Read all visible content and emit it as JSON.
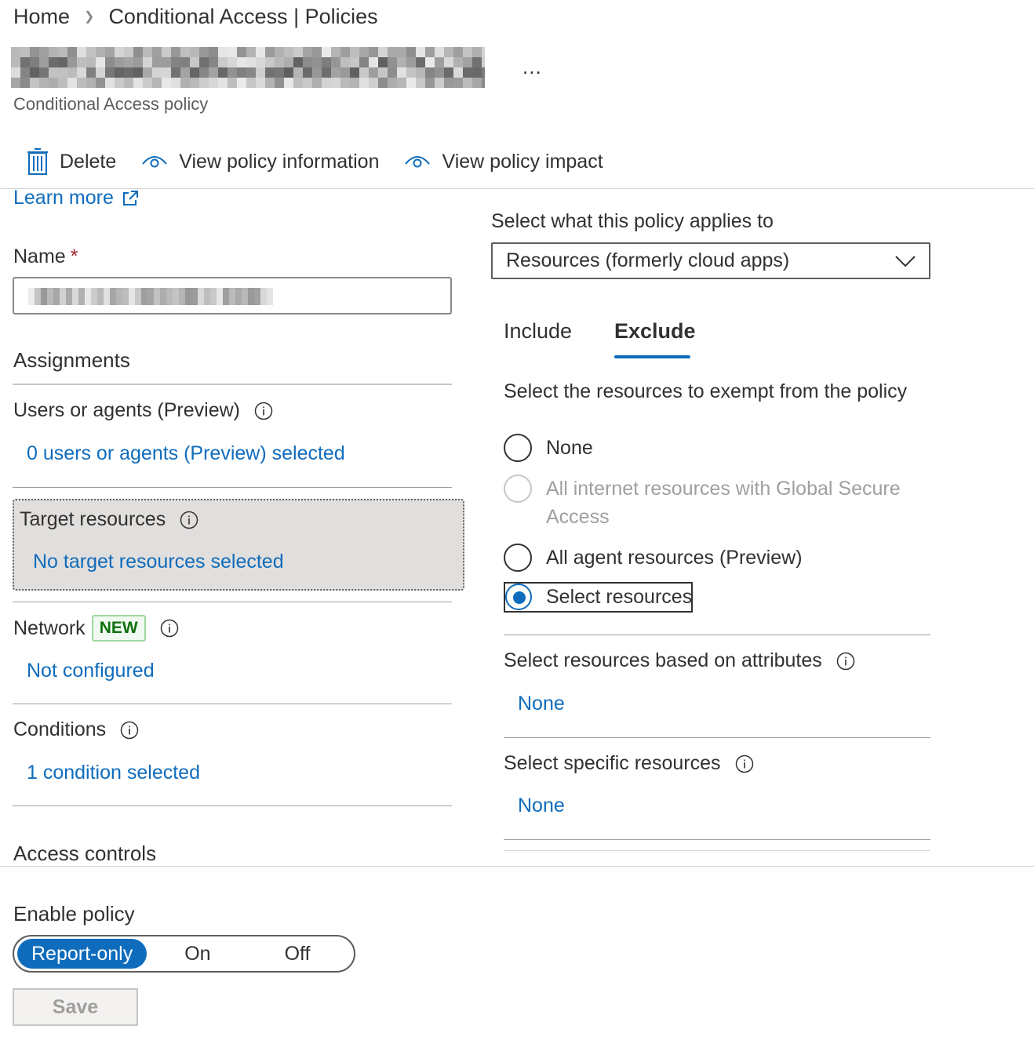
{
  "breadcrumb": {
    "home": "Home",
    "current": "Conditional Access | Policies"
  },
  "header": {
    "more": "...",
    "subtitle": "Conditional Access policy"
  },
  "toolbar": {
    "delete": "Delete",
    "view_info": "View policy information",
    "view_impact": "View policy impact"
  },
  "learn_more": "Learn more",
  "name_field": {
    "label": "Name",
    "required_mark": "*",
    "value": ""
  },
  "assignments": {
    "heading": "Assignments",
    "users": {
      "label": "Users or agents (Preview)",
      "value": "0 users or agents (Preview) selected"
    },
    "target": {
      "label": "Target resources",
      "value": "No target resources selected"
    },
    "network": {
      "label": "Network",
      "badge": "NEW",
      "value": "Not configured"
    },
    "conditions": {
      "label": "Conditions",
      "value": "1 condition selected"
    }
  },
  "access_controls": {
    "heading": "Access controls"
  },
  "right": {
    "applies_label": "Select what this policy applies to",
    "applies_value": "Resources (formerly cloud apps)",
    "tabs": [
      "Include",
      "Exclude"
    ],
    "active_tab": "Exclude",
    "exempt_label": "Select the resources to exempt from the policy",
    "radios": [
      {
        "label": "None",
        "state": "unchecked"
      },
      {
        "label_line1": "All internet resources with Global Secure",
        "label_line2": "Access",
        "state": "disabled"
      },
      {
        "label": "All agent resources (Preview)",
        "state": "unchecked"
      },
      {
        "label": "Select resources",
        "state": "checked"
      }
    ],
    "attributes": {
      "label": "Select resources based on attributes",
      "value": "None"
    },
    "specific": {
      "label": "Select specific resources",
      "value": "None"
    }
  },
  "enable_policy": {
    "label": "Enable policy",
    "options": [
      "Report-only",
      "On",
      "Off"
    ],
    "selected": "Report-only"
  },
  "save_label": "Save",
  "colors": {
    "accent": "#0f6cbd",
    "badge_green": "#0e700e",
    "required_red": "#a4262c"
  }
}
